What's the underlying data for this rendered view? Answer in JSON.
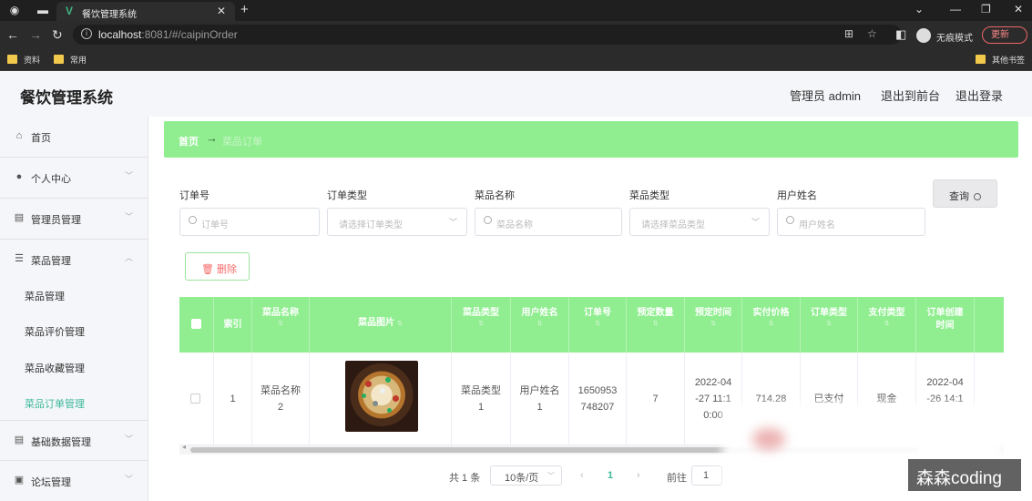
{
  "browser": {
    "tab_title": "餐饮管理系统",
    "url_host": "localhost",
    "url_rest": ":8081/#/caipinOrder",
    "incognito_label": "无痕模式",
    "update_label": "更新",
    "bookmarks": [
      "资料",
      "常用"
    ],
    "other_bookmarks": "其他书签"
  },
  "header": {
    "title": "餐饮管理系统",
    "user": "管理员 admin",
    "to_front": "退出到前台",
    "logout": "退出登录"
  },
  "sidebar": {
    "items": [
      {
        "label": "首页",
        "icon": "home-icon"
      },
      {
        "label": "个人中心",
        "icon": "user-icon"
      },
      {
        "label": "管理员管理",
        "icon": "clipboard-icon"
      },
      {
        "label": "菜品管理",
        "icon": "sliders-icon"
      },
      {
        "label": "基础数据管理",
        "icon": "clipboard-icon"
      },
      {
        "label": "论坛管理",
        "icon": "briefcase-icon"
      }
    ],
    "subitems": [
      "菜品管理",
      "菜品评价管理",
      "菜品收藏管理",
      "菜品订单管理"
    ],
    "active_color": "#3cb89a"
  },
  "breadcrumb": {
    "home": "首页",
    "current": "菜品订单"
  },
  "filters": {
    "order_no": {
      "label": "订单号",
      "placeholder": "订单号"
    },
    "order_type": {
      "label": "订单类型",
      "placeholder": "请选择订单类型"
    },
    "dish_name": {
      "label": "菜品名称",
      "placeholder": "菜品名称"
    },
    "dish_type": {
      "label": "菜品类型",
      "placeholder": "请选择菜品类型"
    },
    "user_name": {
      "label": "用户姓名",
      "placeholder": "用户姓名"
    },
    "query": "查询"
  },
  "actions": {
    "delete": "删除"
  },
  "table": {
    "header_color": "#90ee90",
    "columns": [
      "索引",
      "菜品名称",
      "菜品图片",
      "菜品类型",
      "用户姓名",
      "订单号",
      "预定数量",
      "预定时间",
      "实付价格",
      "订单类型",
      "支付类型",
      "订单创建",
      "时间"
    ],
    "row": {
      "index": "1",
      "dish_name_1": "菜品名称",
      "dish_name_2": "2",
      "dish_type_1": "菜品类型",
      "dish_type_2": "1",
      "user_1": "用户姓名",
      "user_2": "1",
      "order_no_1": "1650953",
      "order_no_2": "748207",
      "qty": "7",
      "book_time_1": "2022-04",
      "book_time_2": "-27 11:1",
      "book_time_3": "0:00",
      "price": "714.28",
      "order_type": "已支付",
      "pay_type": "现金",
      "created_1": "2022-04",
      "created_2": "-26 14:1"
    }
  },
  "pagination": {
    "total": "共 1 条",
    "page_size": "10条/页",
    "current": "1",
    "goto": "前往",
    "goto_value": "1"
  },
  "watermark": "森森coding"
}
